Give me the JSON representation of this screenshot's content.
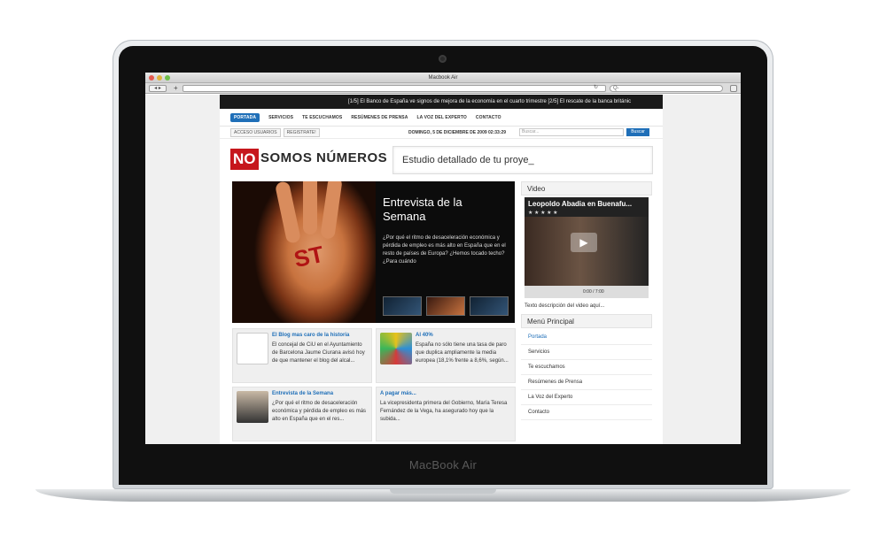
{
  "window": {
    "title": "Macbook Air"
  },
  "laptop": {
    "brand": "MacBook Air"
  },
  "browser": {
    "search_placeholder": "Q-"
  },
  "ticker": {
    "text": "[1/5] El Banco de España ve signos de mejora de la economía en el cuarto trimestre      [2/5] El rescate de la banca británic"
  },
  "nav": {
    "items": [
      "PORTADA",
      "SERVICIOS",
      "TE ESCUCHAMOS",
      "RESÚMENES DE PRENSA",
      "LA VOZ DEL EXPERTO",
      "CONTACTO"
    ]
  },
  "userbar": {
    "acceso": "ACCESO USUARIOS",
    "registrate": "REGISTRATE!",
    "date": "DOMINGO, 5 DE DICIEMBRE DE 2009 02:33:29",
    "search_placeholder": "Buscar...",
    "search_button": "Buscar"
  },
  "logo": {
    "no": "NO",
    "rest": "SOMOS NÚMEROS"
  },
  "tagline": "Estudio detallado de tu proye_",
  "feature": {
    "title": "Entrevista de la Semana",
    "text": "¿Por qué el ritmo de desaceleración económica y pérdida de empleo es más alto en España que en el resto de países de Europa? ¿Hemos tocado techo? ¿Para cuándo",
    "scribble": "ST"
  },
  "cards": [
    {
      "title": "El Blog mas caro de la historia",
      "text": "El concejal de CiU en el Ayuntamiento de Barcelona Jaume Ciurana avisó hoy de que mantener el blog del alcal..."
    },
    {
      "title": "Al 40%",
      "text": "España no sólo tiene una tasa de paro que duplica ampliamente la media europea (18,1% frente a 8,6%, según..."
    },
    {
      "title": "Entrevista de la Semana",
      "text": "¿Por qué el ritmo de desaceleración económica y pérdida de empleo es más alto en España que en el res..."
    },
    {
      "title": "A pagar más...",
      "text": "La vicepresidenta primera del Gobierno, María Teresa Fernández de la Vega, ha asegurado hoy que la subida..."
    }
  ],
  "video": {
    "heading": "Video",
    "title": "Leopoldo Abadia en Buenafu...",
    "stars": "★ ★ ★ ★ ★",
    "time": "0:00 / 7:00",
    "description": "Texto descripción del video aquí..."
  },
  "menu": {
    "heading": "Menú Principal",
    "items": [
      "Portada",
      "Servicios",
      "Te escuchamos",
      "Resúmenes de Prensa",
      "La Voz del Experto",
      "Contacto"
    ]
  },
  "colors": {
    "accent": "#1f6fb8",
    "logo_red": "#c6161c"
  }
}
